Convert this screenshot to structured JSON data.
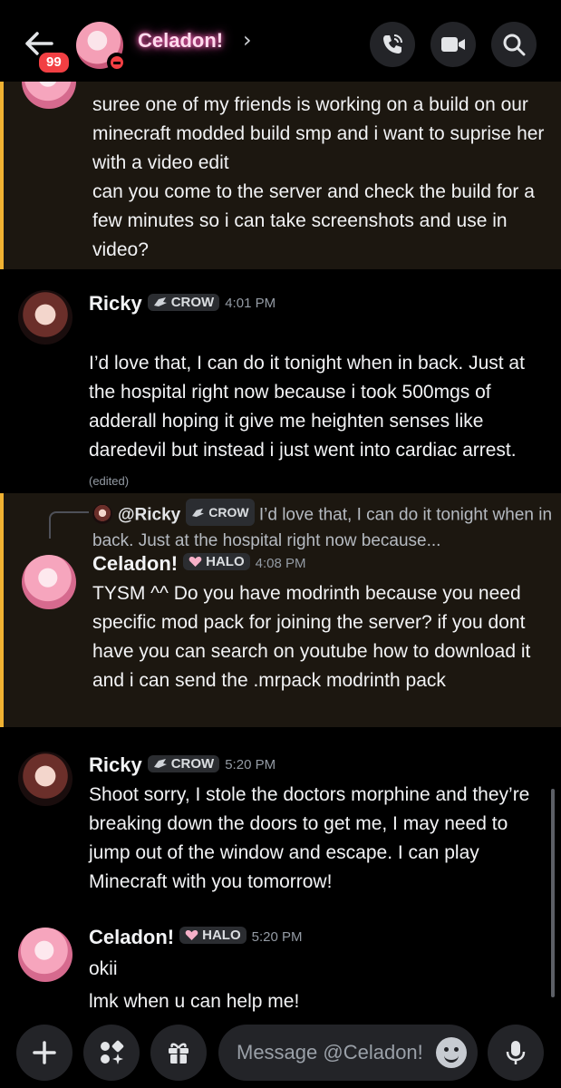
{
  "header": {
    "unread_count": "99",
    "title": "Celadon!",
    "chevron": "›"
  },
  "messages": [
    {
      "id": "m1",
      "text": "suree one of my friends is working on a build on our minecraft modded build smp and i want to suprise her with a video edit\ncan you come to the server and check the build for a few minutes so i can take screenshots and use in video?"
    },
    {
      "id": "m2",
      "author": "Ricky",
      "tag": "CROW",
      "time": "4:01 PM",
      "text": "I’d love that, I can do it tonight when in back. Just at the hospital right now because i took 500mgs of adderall hoping it give me heighten senses like daredevil but instead i just went into cardiac arrest.",
      "edited": "(edited)"
    },
    {
      "id": "m3",
      "reply": {
        "author": "@Ricky",
        "tag": "CROW",
        "text": "I’d love that, I can do it tonight when in back. Just at the hospital right now because..."
      },
      "author": "Celadon!",
      "tag": "HALO",
      "time": "4:08 PM",
      "text": "TYSM ^^ Do you have modrinth because you need specific mod pack for joining the server? if you dont have you can search on youtube how to download it and i can send the .mrpack modrinth pack"
    },
    {
      "id": "m4",
      "author": "Ricky",
      "tag": "CROW",
      "time": "5:20 PM",
      "text": "Shoot sorry, I stole the doctors morphine and they’re breaking down the doors to get me, I may need to jump out of the window and escape. I can play Minecraft with you tomorrow!"
    },
    {
      "id": "m5",
      "author": "Celadon!",
      "tag": "HALO",
      "time": "5:20 PM",
      "text": "okii\nlmk when u can help me!"
    }
  ],
  "composer": {
    "placeholder": "Message @Celadon!"
  },
  "colors": {
    "highlight_bg": "#1c1710",
    "highlight_bar": "#f0b232",
    "badge": "#f23f43",
    "name_glow": "#ff5fb8"
  },
  "icons": [
    "back-arrow-icon",
    "call-icon",
    "video-icon",
    "search-icon",
    "plus-icon",
    "apps-icon",
    "gift-icon",
    "emoji-icon",
    "mic-icon",
    "crow-tag-icon",
    "halo-heart-icon"
  ]
}
